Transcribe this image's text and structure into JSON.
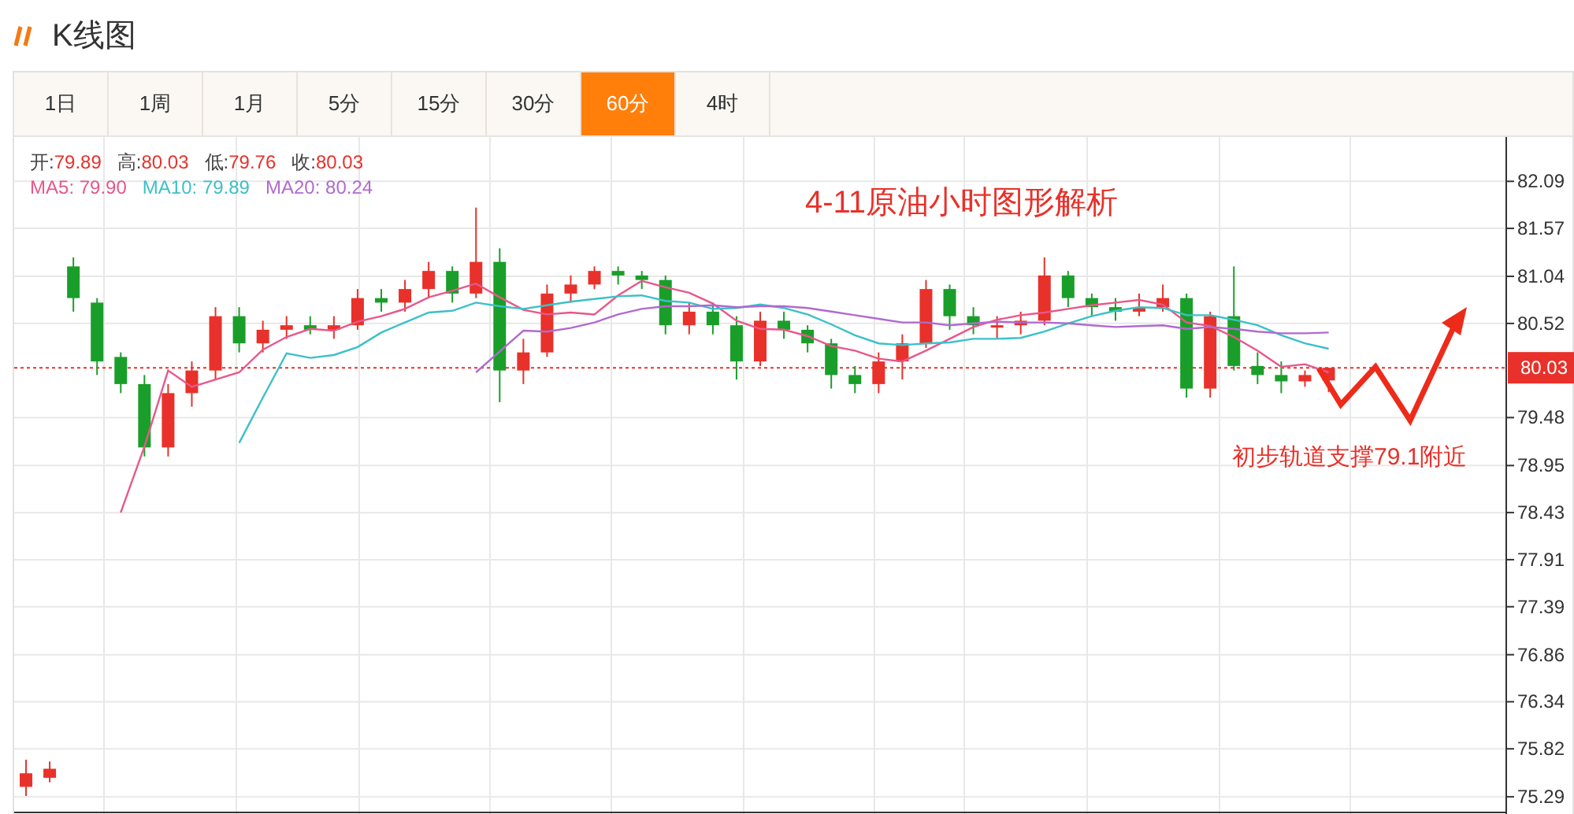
{
  "header": {
    "title": "K线图"
  },
  "tabs": [
    {
      "label": "1日",
      "selected": false
    },
    {
      "label": "1周",
      "selected": false
    },
    {
      "label": "1月",
      "selected": false
    },
    {
      "label": "5分",
      "selected": false
    },
    {
      "label": "15分",
      "selected": false
    },
    {
      "label": "30分",
      "selected": false
    },
    {
      "label": "60分",
      "selected": true
    },
    {
      "label": "4时",
      "selected": false
    }
  ],
  "legend": {
    "ohlc": [
      {
        "label": "开:",
        "value": "79.89"
      },
      {
        "label": "高:",
        "value": "80.03"
      },
      {
        "label": "低:",
        "value": "79.76"
      },
      {
        "label": "收:",
        "value": "80.03"
      }
    ],
    "ma": [
      {
        "separator": ":",
        "value": "79.90"
      },
      {
        "separator": ":",
        "value": "79.89"
      },
      {
        "separator": ":",
        "value": "80.24"
      }
    ]
  },
  "chart_data": {
    "type": "candlestick",
    "title": "4-11原油小时图形解析",
    "grid": true,
    "ylim": [
      75.1,
      82.58
    ],
    "yticks": [
      82.09,
      81.57,
      81.04,
      80.52,
      79.48,
      78.95,
      78.43,
      77.91,
      77.39,
      76.86,
      76.34,
      75.82,
      75.29
    ],
    "categories": [
      null,
      null,
      null,
      null,
      null,
      null,
      null,
      null,
      null,
      null,
      null,
      null,
      null,
      null,
      null,
      null,
      null,
      null,
      null,
      null,
      null,
      null,
      null,
      null,
      null,
      null,
      null,
      null,
      null,
      null,
      null,
      null,
      null,
      null,
      null,
      null,
      null,
      null,
      null,
      null,
      null,
      null,
      null,
      null,
      null,
      null,
      null,
      null,
      null,
      null,
      null,
      null,
      null,
      null,
      null,
      null,
      null,
      null,
      null,
      null,
      null,
      null,
      null
    ],
    "ohlc": [
      [
        75.4,
        75.7,
        75.3,
        75.55
      ],
      [
        75.5,
        75.68,
        75.45,
        75.6
      ],
      [
        81.15,
        81.25,
        80.65,
        80.8
      ],
      [
        80.75,
        80.8,
        79.95,
        80.1
      ],
      [
        80.15,
        80.2,
        79.75,
        79.85
      ],
      [
        79.85,
        79.95,
        79.05,
        79.15
      ],
      [
        79.15,
        79.85,
        79.05,
        79.75
      ],
      [
        79.75,
        80.1,
        79.6,
        80.0
      ],
      [
        80.0,
        80.7,
        79.9,
        80.6
      ],
      [
        80.6,
        80.7,
        80.2,
        80.3
      ],
      [
        80.3,
        80.55,
        80.2,
        80.45
      ],
      [
        80.45,
        80.6,
        80.35,
        80.5
      ],
      [
        80.5,
        80.6,
        80.4,
        80.45
      ],
      [
        80.45,
        80.6,
        80.35,
        80.5
      ],
      [
        80.5,
        80.9,
        80.45,
        80.8
      ],
      [
        80.8,
        80.9,
        80.65,
        80.75
      ],
      [
        80.75,
        81.0,
        80.65,
        80.9
      ],
      [
        80.9,
        81.2,
        80.8,
        81.1
      ],
      [
        81.1,
        81.15,
        80.75,
        80.85
      ],
      [
        80.85,
        81.8,
        80.8,
        81.2
      ],
      [
        81.2,
        81.35,
        79.65,
        80.0
      ],
      [
        80.0,
        80.35,
        79.85,
        80.2
      ],
      [
        80.2,
        80.95,
        80.15,
        80.85
      ],
      [
        80.85,
        81.05,
        80.75,
        80.95
      ],
      [
        80.95,
        81.15,
        80.9,
        81.1
      ],
      [
        81.1,
        81.15,
        80.95,
        81.05
      ],
      [
        81.05,
        81.1,
        80.9,
        81.0
      ],
      [
        81.0,
        81.05,
        80.4,
        80.5
      ],
      [
        80.5,
        80.75,
        80.4,
        80.65
      ],
      [
        80.65,
        80.75,
        80.4,
        80.5
      ],
      [
        80.5,
        80.6,
        79.9,
        80.1
      ],
      [
        80.1,
        80.65,
        80.05,
        80.55
      ],
      [
        80.55,
        80.65,
        80.35,
        80.45
      ],
      [
        80.45,
        80.5,
        80.2,
        80.3
      ],
      [
        80.3,
        80.35,
        79.8,
        79.95
      ],
      [
        79.95,
        80.05,
        79.75,
        79.85
      ],
      [
        79.85,
        80.2,
        79.75,
        80.1
      ],
      [
        80.1,
        80.4,
        79.9,
        80.3
      ],
      [
        80.3,
        81.0,
        80.25,
        80.9
      ],
      [
        80.9,
        80.95,
        80.45,
        80.6
      ],
      [
        80.6,
        80.7,
        80.4,
        80.5
      ],
      [
        80.48,
        80.6,
        80.35,
        80.5
      ],
      [
        80.5,
        80.65,
        80.4,
        80.55
      ],
      [
        80.55,
        81.25,
        80.5,
        81.05
      ],
      [
        81.05,
        81.1,
        80.7,
        80.8
      ],
      [
        80.8,
        80.85,
        80.6,
        80.7
      ],
      [
        80.7,
        80.8,
        80.55,
        80.65
      ],
      [
        80.65,
        80.85,
        80.6,
        80.7
      ],
      [
        80.7,
        80.95,
        80.65,
        80.8
      ],
      [
        80.8,
        80.85,
        79.7,
        79.8
      ],
      [
        79.8,
        80.65,
        79.7,
        80.6
      ],
      [
        80.6,
        81.15,
        80.0,
        80.05
      ],
      [
        80.05,
        80.2,
        79.85,
        79.95
      ],
      [
        79.95,
        80.1,
        79.75,
        79.88
      ],
      [
        79.88,
        80.0,
        79.82,
        79.95
      ],
      [
        79.89,
        80.03,
        79.76,
        80.03
      ],
      null,
      null,
      null,
      null,
      null,
      null,
      null
    ],
    "series": [
      {
        "name": "MA5",
        "type": "line",
        "color": "#e8578a",
        "values": [
          null,
          null,
          null,
          null,
          78.43,
          79.16,
          80.0,
          79.82,
          79.9,
          79.98,
          80.23,
          80.37,
          80.46,
          80.44,
          80.54,
          80.6,
          80.68,
          80.81,
          80.88,
          80.96,
          80.81,
          80.67,
          80.62,
          80.64,
          80.62,
          80.83,
          80.99,
          80.92,
          80.86,
          80.74,
          80.55,
          80.46,
          80.45,
          80.38,
          80.27,
          80.22,
          80.13,
          80.1,
          80.22,
          80.35,
          80.48,
          80.56,
          80.61,
          80.64,
          80.68,
          80.72,
          80.75,
          80.78,
          80.73,
          80.53,
          80.49,
          80.37,
          80.22,
          80.04,
          80.07,
          79.98,
          null,
          null,
          null,
          null,
          null,
          null,
          null
        ]
      },
      {
        "name": "MA10",
        "type": "line",
        "color": "#3cc0c8",
        "values": [
          null,
          null,
          null,
          null,
          null,
          null,
          null,
          null,
          null,
          79.2,
          79.7,
          80.19,
          80.14,
          80.17,
          80.26,
          80.42,
          80.53,
          80.64,
          80.66,
          80.75,
          80.71,
          80.68,
          80.72,
          80.76,
          80.79,
          80.82,
          80.83,
          80.77,
          80.75,
          80.68,
          80.69,
          80.73,
          80.69,
          80.62,
          80.51,
          80.39,
          80.3,
          80.28,
          80.3,
          80.31,
          80.35,
          80.35,
          80.36,
          80.43,
          80.52,
          80.6,
          80.66,
          80.7,
          80.69,
          80.61,
          80.61,
          80.56,
          80.5,
          80.39,
          80.3,
          80.24,
          null,
          null,
          null,
          null,
          null,
          null,
          null
        ]
      },
      {
        "name": "MA20",
        "type": "line",
        "color": "#b06ad0",
        "values": [
          null,
          null,
          null,
          null,
          null,
          null,
          null,
          null,
          null,
          null,
          null,
          null,
          null,
          null,
          null,
          null,
          null,
          null,
          null,
          79.98,
          80.21,
          80.44,
          80.43,
          80.47,
          80.53,
          80.62,
          80.68,
          80.71,
          80.71,
          80.72,
          80.7,
          80.71,
          80.71,
          80.69,
          80.65,
          80.61,
          80.57,
          80.53,
          80.53,
          80.5,
          80.52,
          80.54,
          80.53,
          80.53,
          80.52,
          80.5,
          80.48,
          80.49,
          80.5,
          80.46,
          80.48,
          80.46,
          80.43,
          80.41,
          80.41,
          80.42,
          null,
          null,
          null,
          null,
          null,
          null,
          null
        ]
      }
    ],
    "ref_lines": [
      {
        "axis": "y",
        "value": 80.03,
        "label": "80.03"
      }
    ],
    "annotations": [
      {
        "text": "初步轨道支撑79.1附近"
      }
    ]
  }
}
